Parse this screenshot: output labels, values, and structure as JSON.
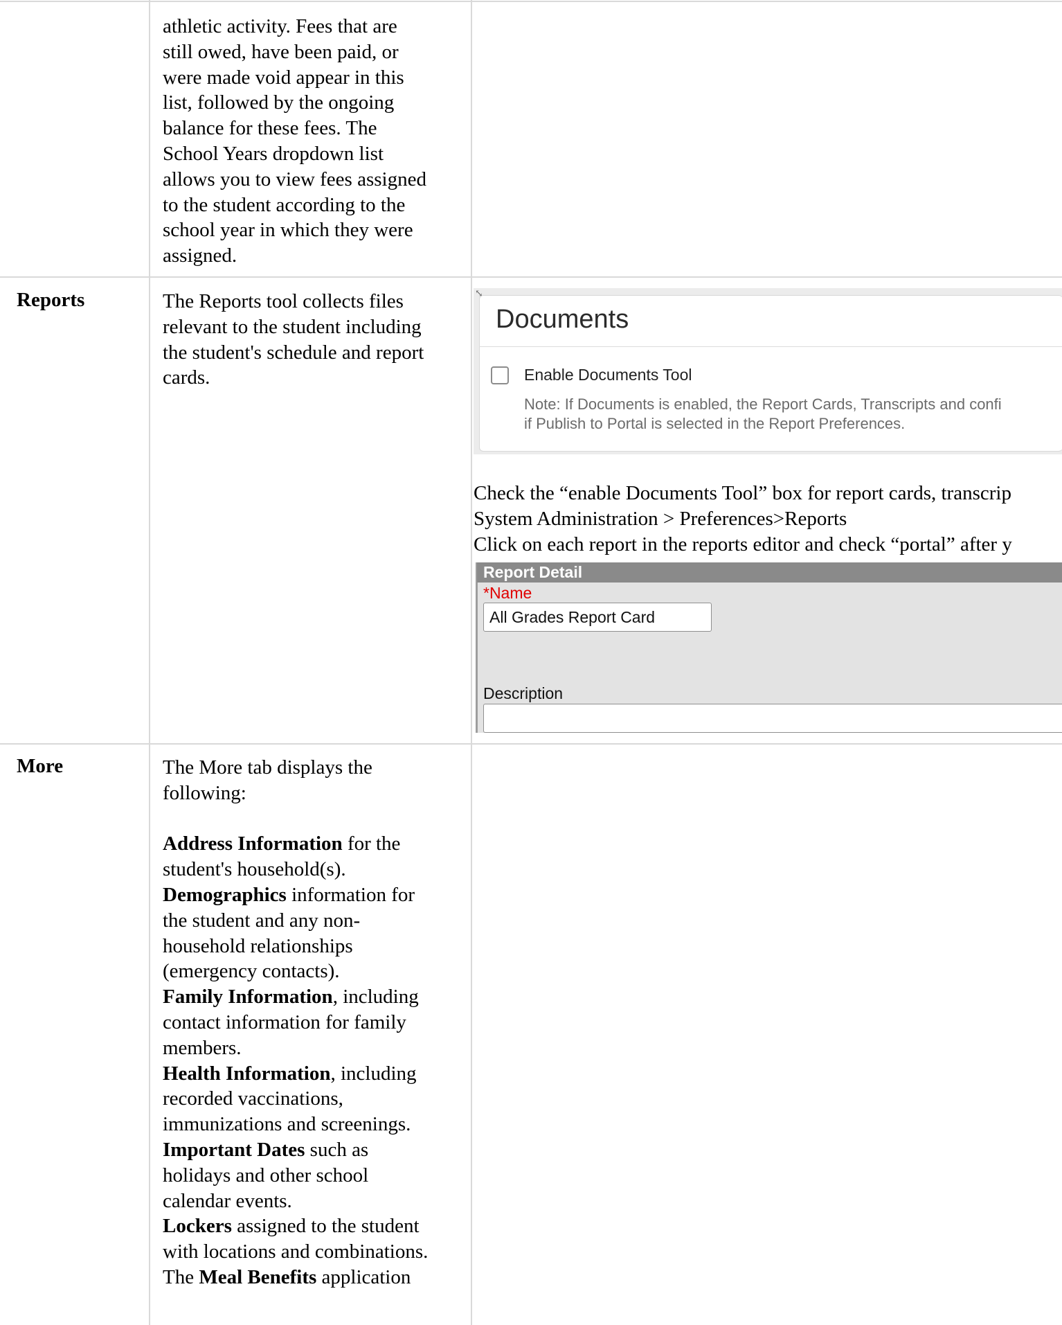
{
  "fees_row": {
    "description_lines": [
      "athletic activity. Fees that are",
      "still owed, have been paid, or",
      "were made void appear in this",
      "list, followed by the ongoing",
      "balance for these fees. The",
      "School Years dropdown list",
      "allows you to view fees assigned",
      "to the student according to the",
      "school year in which they were",
      "assigned."
    ]
  },
  "reports_row": {
    "label": "Reports",
    "description_lines": [
      "The Reports tool collects files",
      "relevant to the student including",
      "the student's schedule and report",
      "cards."
    ],
    "documents_panel": {
      "title": "Documents",
      "checkbox_label": "Enable Documents Tool",
      "note_line1": "Note: If Documents is enabled, the Report Cards, Transcripts and confi",
      "note_line2": "if Publish to Portal is selected in the Report Preferences."
    },
    "instructions": [
      "Check the “enable Documents Tool” box for report cards, transcrip",
      "System Administration > Preferences>Reports",
      "Click on each report in the reports editor and check “portal” after y"
    ],
    "report_detail": {
      "header": "Report Detail",
      "name_label": "*Name",
      "name_value": "All Grades Report Card",
      "description_label": "Description"
    }
  },
  "more_row": {
    "label": "More",
    "intro_lines": [
      "The More tab displays the",
      "following:"
    ],
    "items": {
      "address_bold": "Address Information",
      "address_rest1": " for the",
      "address_rest2": "student's household(s).",
      "demo_bold": "Demographics",
      "demo_rest1": " information for",
      "demo_rest2": "the student and any non-",
      "demo_rest3": "household relationships",
      "demo_rest4": "(emergency contacts).",
      "family_bold": "Family Information",
      "family_rest1": ", including",
      "family_rest2": "contact information for family",
      "family_rest3": "members.",
      "health_bold": "Health Information",
      "health_rest1": ", including",
      "health_rest2": "recorded vaccinations,",
      "health_rest3": "immunizations and screenings.",
      "dates_bold": "Important Dates",
      "dates_rest1": " such as",
      "dates_rest2": "holidays and other school",
      "dates_rest3": "calendar events.",
      "lockers_bold": "Lockers",
      "lockers_rest1": " assigned to the student",
      "lockers_rest2": "with locations and combinations.",
      "meal_pre": "The ",
      "meal_bold": "Meal Benefits",
      "meal_rest": " application"
    }
  }
}
